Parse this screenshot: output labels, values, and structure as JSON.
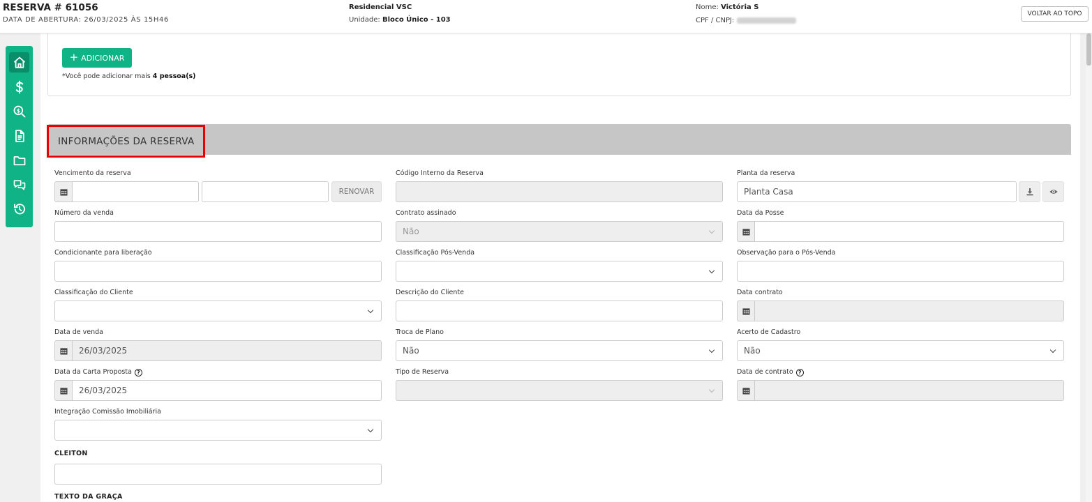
{
  "header": {
    "title": "RESERVA # 61056",
    "opened": "DATA DE ABERTURA: 26/03/2025 ÀS 15H46",
    "project": "Residencial VSC",
    "unit_label": "Unidade:",
    "unit_value": "Bloco Único - 103",
    "name_label": "Nome:",
    "name_value": "Victória S",
    "cpf_label": "CPF / CNPJ:",
    "back_top": "VOLTAR AO TOPO"
  },
  "sidebar": {
    "items": [
      {
        "icon": "home-icon"
      },
      {
        "icon": "dollar-icon"
      },
      {
        "icon": "search-money-icon"
      },
      {
        "icon": "document-icon"
      },
      {
        "icon": "folder-icon"
      },
      {
        "icon": "chat-icon"
      },
      {
        "icon": "history-icon"
      }
    ]
  },
  "people": {
    "add_label": "ADICIONAR",
    "note_prefix": "*Você pode adicionar mais",
    "note_count": "4 pessoa(s)"
  },
  "section": {
    "title": "INFORMAÇÕES DA RESERVA"
  },
  "fields": {
    "vencimento": {
      "label": "Vencimento da reserva",
      "renew": "RENOVAR"
    },
    "codigo_interno": {
      "label": "Código Interno da Reserva"
    },
    "planta": {
      "label": "Planta da reserva",
      "value": "Planta Casa"
    },
    "numero_venda": {
      "label": "Número da venda"
    },
    "contrato_assinado": {
      "label": "Contrato assinado",
      "value": "Não"
    },
    "data_posse": {
      "label": "Data da Posse"
    },
    "condicionante": {
      "label": "Condicionante para liberação"
    },
    "classificacao_pos": {
      "label": "Classificação Pós-Venda"
    },
    "observacao_pos": {
      "label": "Observação para o Pós-Venda"
    },
    "classificacao_cliente": {
      "label": "Classificação do Cliente"
    },
    "descricao_cliente": {
      "label": "Descrição do Cliente"
    },
    "data_contrato_1": {
      "label": "Data contrato"
    },
    "data_venda": {
      "label": "Data de venda",
      "value": "26/03/2025"
    },
    "troca_plano": {
      "label": "Troca de Plano",
      "value": "Não"
    },
    "acerto_cadastro": {
      "label": "Acerto de Cadastro",
      "value": "Não"
    },
    "data_carta": {
      "label": "Data da Carta Proposta",
      "value": "26/03/2025"
    },
    "tipo_reserva": {
      "label": "Tipo de Reserva"
    },
    "data_contrato_2": {
      "label": "Data de contrato"
    },
    "integracao": {
      "label": "Integração Comissão Imobiliária"
    },
    "cleiton": {
      "label": "CLEITON"
    },
    "texto_graca": {
      "label": "TEXTO DA GRAÇA"
    }
  },
  "colors": {
    "accent": "#10b386",
    "accent_dark": "#0a8d69",
    "section_bar": "#c6c6c6",
    "highlight": "#e60000"
  }
}
